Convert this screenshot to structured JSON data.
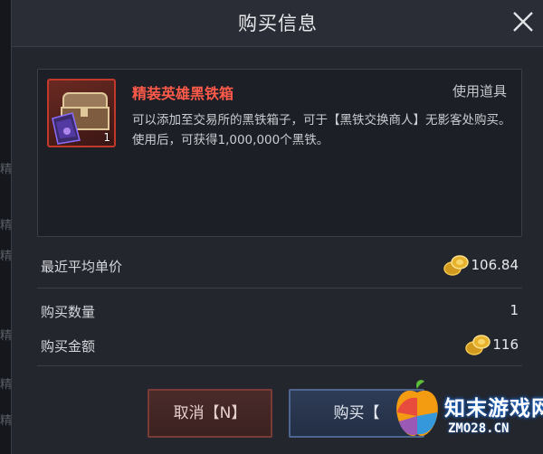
{
  "background": {
    "left_chars": [
      "精",
      "精",
      "精",
      "精",
      "精",
      "精"
    ]
  },
  "dialog": {
    "title": "购买信息",
    "close_icon": "close-icon"
  },
  "item": {
    "name": "精装英雄黑铁箱",
    "type": "使用道具",
    "count": "1",
    "description": "可以添加至交易所的黑铁箱子，可于【黑铁交换商人】无影客处购买。使用后，可获得1,000,000个黑铁。",
    "name_color": "#ff5a4a",
    "icon": "treasure-chest-icon"
  },
  "rows": {
    "avg_price_label": "最近平均单价",
    "avg_price_value": "106.84",
    "quantity_label": "购买数量",
    "quantity_value": "1",
    "total_label": "购买金额",
    "total_value": "116",
    "currency_icon": "gold-coin-icon"
  },
  "buttons": {
    "cancel_label": "取消【N】",
    "buy_label": "购买【"
  },
  "watermark": {
    "text": "知末游戏网",
    "url": "ZMO28.CN"
  }
}
